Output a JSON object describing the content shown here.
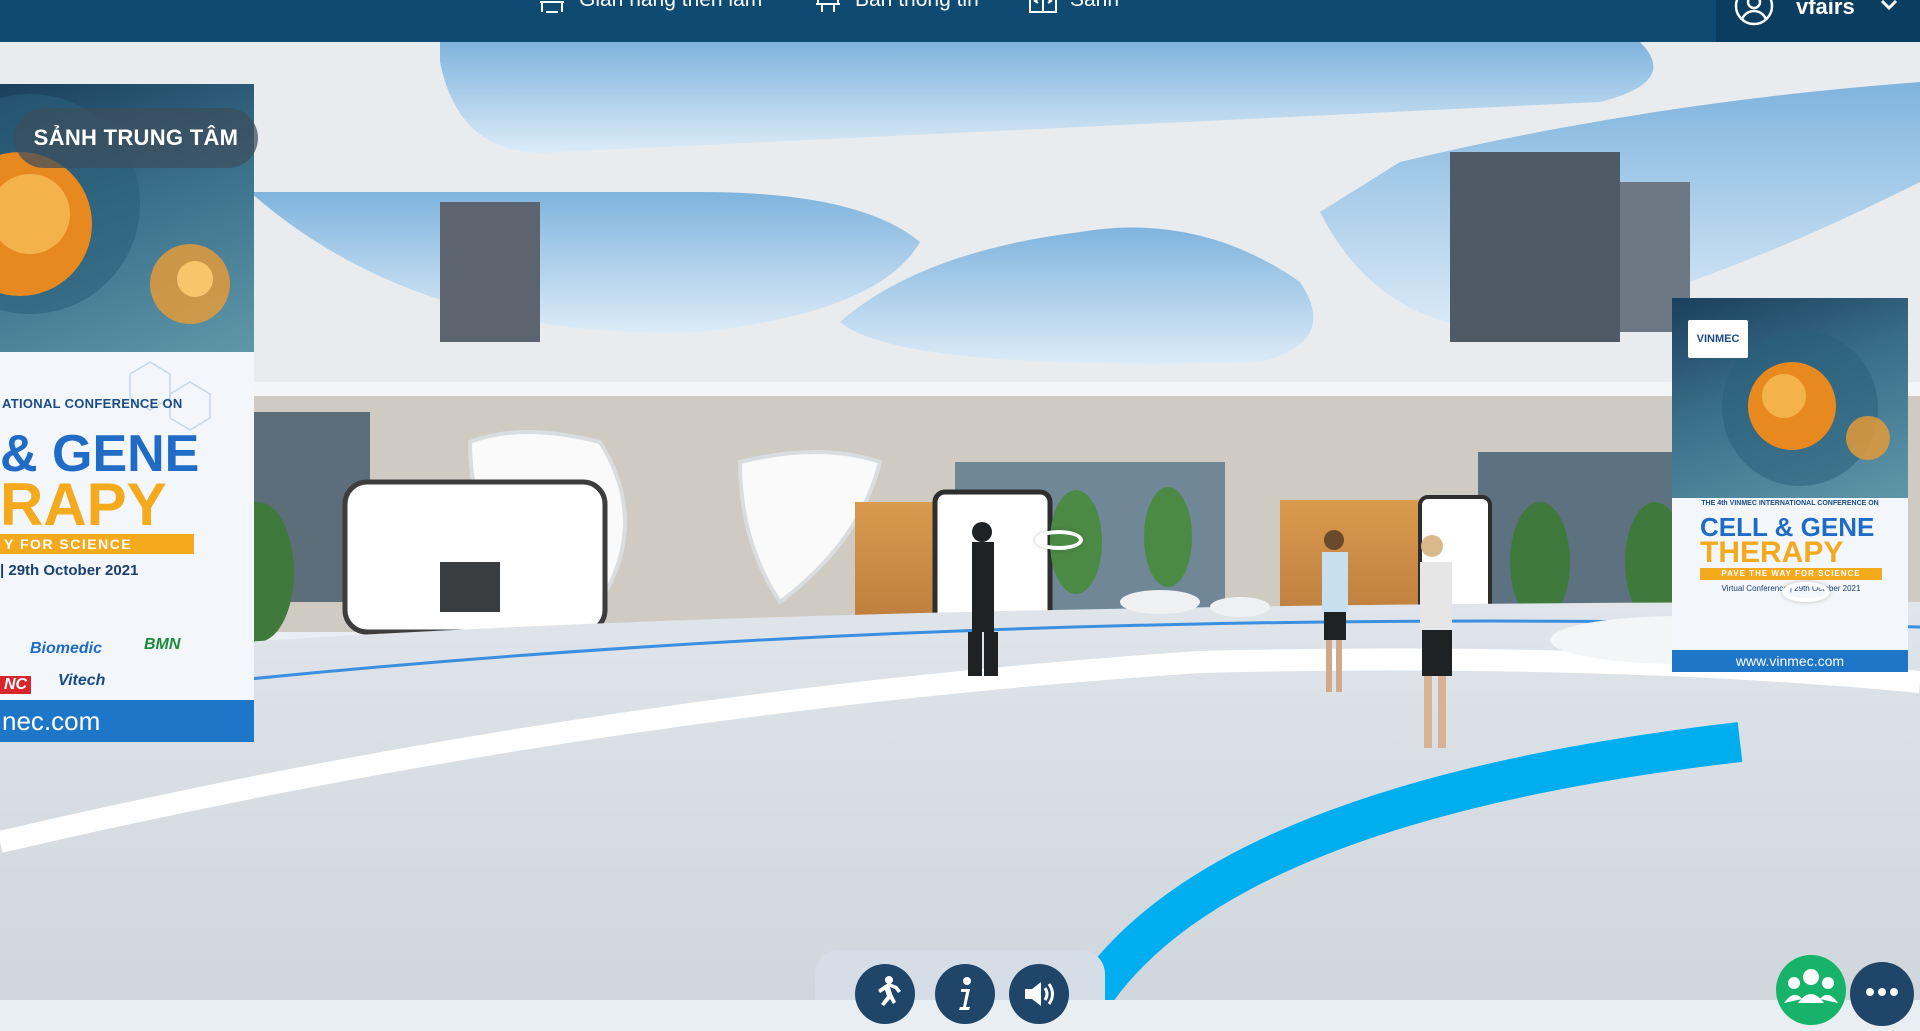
{
  "topbar": {
    "nav": [
      {
        "label": "Gian hàng triển lãm",
        "icon": "booth-icon"
      },
      {
        "label": "Bản thông tin",
        "icon": "info-board-icon"
      },
      {
        "label": "Sảnh",
        "icon": "lobby-door-icon"
      }
    ],
    "user": {
      "name": "vfairs",
      "icon": "user-avatar-icon"
    }
  },
  "scene": {
    "location_label": "SẢNH TRUNG TÂM",
    "banner_left": {
      "small_heading": "ATIONAL CONFERENCE ON",
      "line1": "& GENE",
      "line2": "RAPY",
      "strip": "Y FOR SCIENCE",
      "date": "| 29th October 2021",
      "sponsors": [
        "Biomedic",
        "BMN",
        "Vitech",
        "NC"
      ],
      "footer": "nec.com"
    },
    "banner_right": {
      "logo": "VINMEC",
      "small_heading": "THE 4th VINMEC INTERNATIONAL CONFERENCE ON",
      "line1": "CELL & GENE",
      "line2": "THERAPY",
      "strip": "PAVE THE WAY FOR SCIENCE",
      "date": "Virtual Conference | 29th October 2021",
      "footer": "www.vinmec.com"
    }
  },
  "controls": {
    "buttons": [
      "walk-icon",
      "info-icon",
      "sound-icon"
    ],
    "people_icon": "people-icon",
    "more_icon": "more-icon"
  },
  "colors": {
    "topbar": "#0e4a72",
    "accent_blue": "#00aef0",
    "people_button": "#18b36a",
    "control_button": "#1f4569"
  }
}
